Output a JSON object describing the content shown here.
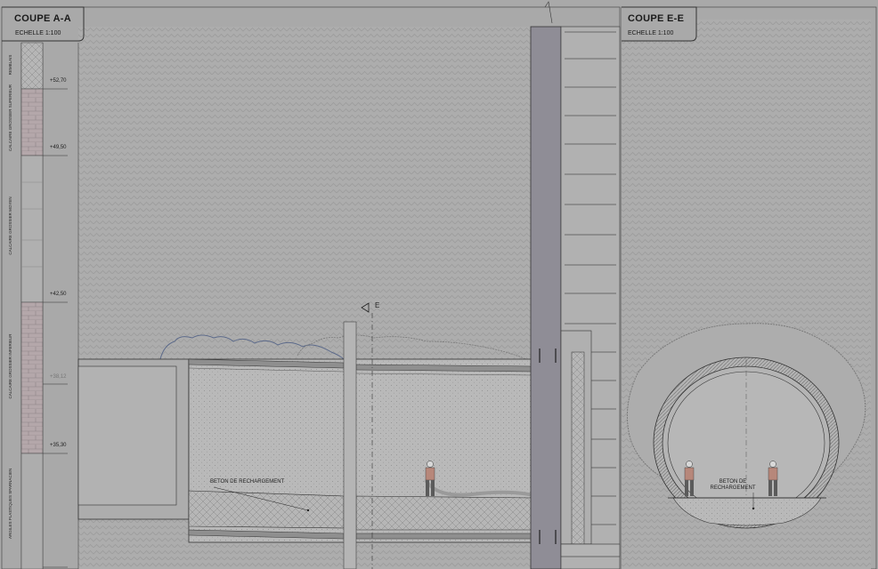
{
  "sections": {
    "a": {
      "title": "COUPE A-A",
      "scale": "ECHELLE 1:100"
    },
    "e": {
      "title": "COUPE E-E",
      "scale": "ECHELLE 1:100"
    }
  },
  "levels": [
    "+52,70",
    "+49,50",
    "+42,50",
    "+38,12",
    "+35,30"
  ],
  "strata": [
    "REMBLAIS",
    "CALCAIRE GROSSIER SUPERIEUR",
    "CALCAIRE GROSSIER MOYEN",
    "CALCAIRE GROSSIER INFERIEUR",
    "ARGILES PLASTIQUES SPARNACIEN"
  ],
  "labels": {
    "beton_a": "BETON DE RECHARGEMENT",
    "beton_e": "BETON DE\nRECHARGEMENT",
    "cut_marker": "E"
  },
  "colors": {
    "background": "#a9a9a9",
    "line": "#333333",
    "concrete": "#bdbdbd",
    "soil_highlight": "#b8a9ad",
    "grout_outline": "#5c6a8a"
  }
}
